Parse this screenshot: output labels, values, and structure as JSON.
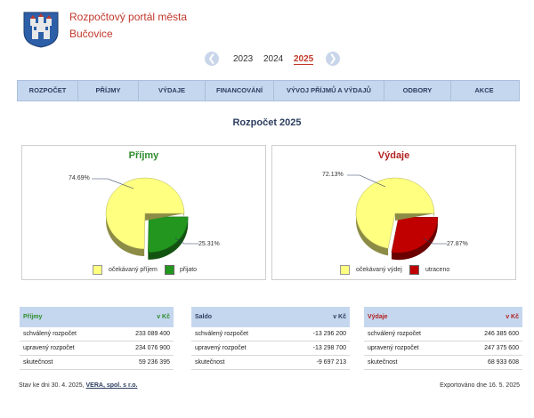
{
  "header": {
    "title_line1": "Rozpočtový portál města",
    "title_line2": "Bučovice"
  },
  "years": {
    "prev_icon": "chevron-left-icon",
    "next_icon": "chevron-right-icon",
    "items": [
      "2023",
      "2024",
      "2025"
    ],
    "active": "2025"
  },
  "nav": {
    "items": [
      "ROZPOČET",
      "PŘÍJMY",
      "VÝDAJE",
      "FINANCOVÁNÍ",
      "VÝVOJ PŘÍJMŮ A VÝDAJŮ",
      "ODBORY",
      "AKCE"
    ]
  },
  "page": {
    "heading": "Rozpočet  2025"
  },
  "charts": {
    "income": {
      "title": "Příjmy",
      "color": "#2e8b2e",
      "legend": [
        "očekávaný příjem",
        "přijato"
      ]
    },
    "expense": {
      "title": "Výdaje",
      "color": "#b22222",
      "legend": [
        "očekávaný výdej",
        "utraceno"
      ]
    }
  },
  "chart_data": [
    {
      "type": "pie",
      "title": "Příjmy",
      "categories": [
        "očekávaný příjem",
        "přijato"
      ],
      "values": [
        74.69,
        25.31
      ],
      "labels": [
        "74.69%",
        "25.31%"
      ],
      "colors": [
        "#ffff80",
        "#22961e"
      ]
    },
    {
      "type": "pie",
      "title": "Výdaje",
      "categories": [
        "očekávaný výdej",
        "utraceno"
      ],
      "values": [
        72.13,
        27.87
      ],
      "labels": [
        "72.13%",
        "27.87%"
      ],
      "colors": [
        "#ffff80",
        "#c00000"
      ]
    }
  ],
  "tables": {
    "income": {
      "title": "Příjmy",
      "unit": "v Kč",
      "color": "#2e8b2e",
      "rows": [
        {
          "label": "schválený rozpočet",
          "value": "233 089 400"
        },
        {
          "label": "upravený rozpočet",
          "value": "234 076 900"
        },
        {
          "label": "skutečnost",
          "value": "59 236 395"
        }
      ]
    },
    "balance": {
      "title": "Saldo",
      "unit": "v Kč",
      "color": "#2c3e60",
      "rows": [
        {
          "label": "schválený rozpočet",
          "value": "-13 296 200"
        },
        {
          "label": "upravený rozpočet",
          "value": "-13 298 700"
        },
        {
          "label": "skutečnost",
          "value": "-9 697 213"
        }
      ]
    },
    "expense": {
      "title": "Výdaje",
      "unit": "v Kč",
      "color": "#b22222",
      "rows": [
        {
          "label": "schválený rozpočet",
          "value": "246 385 600"
        },
        {
          "label": "upravený rozpočet",
          "value": "247 375 600"
        },
        {
          "label": "skutečnost",
          "value": "68 933 608"
        }
      ]
    }
  },
  "footer": {
    "status_prefix": "Stav  ke dni  30. 4. 2025,",
    "company_link": "VERA, spol. s r.o.",
    "exported": "Exportováno dne 16. 5. 2025"
  }
}
